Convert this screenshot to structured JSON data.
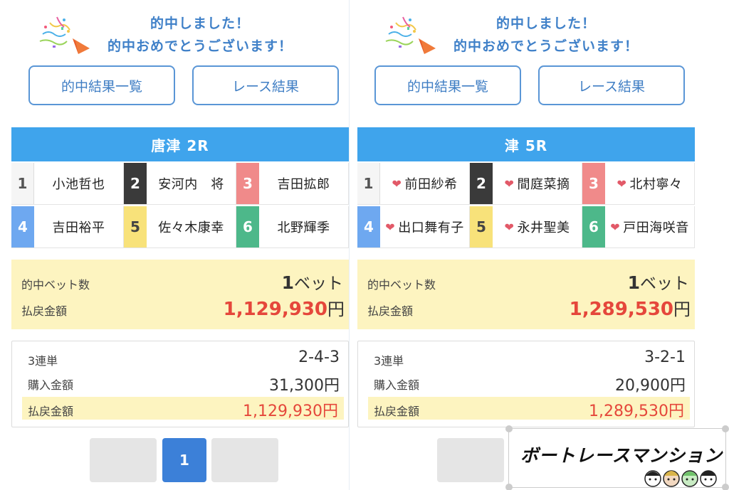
{
  "panels": [
    {
      "congrats_line1": "的中しました！",
      "congrats_line2": "的中おめでとうございます！",
      "btn_results_list": "的中結果一覧",
      "btn_race_results": "レース結果",
      "race_title": "唐津 2R",
      "racers": [
        {
          "boat": "1",
          "name": "小池哲也",
          "heart": false
        },
        {
          "boat": "2",
          "name": "安河内　将",
          "heart": false
        },
        {
          "boat": "3",
          "name": "吉田拡郎",
          "heart": false
        },
        {
          "boat": "4",
          "name": "吉田裕平",
          "heart": false
        },
        {
          "boat": "5",
          "name": "佐々木康幸",
          "heart": false
        },
        {
          "boat": "6",
          "name": "北野輝季",
          "heart": false
        }
      ],
      "hit_bets_label": "的中ベット数",
      "hit_bets_count": "1",
      "hit_bets_unit": "ベット",
      "payout_label": "払戻金額",
      "payout_amount": "1,129,930",
      "yen": "円",
      "bet_type_label": "3連単",
      "bet_combo": "2-4-3",
      "purchase_label": "購入金額",
      "purchase_amount": "31,300円",
      "refund_label": "払戻金額",
      "refund_amount": "1,129,930円",
      "page_current": "1"
    },
    {
      "congrats_line1": "的中しました！",
      "congrats_line2": "的中おめでとうございます！",
      "btn_results_list": "的中結果一覧",
      "btn_race_results": "レース結果",
      "race_title": "津 5R",
      "racers": [
        {
          "boat": "1",
          "name": "前田紗希",
          "heart": true
        },
        {
          "boat": "2",
          "name": "間庭菜摘",
          "heart": true
        },
        {
          "boat": "3",
          "name": "北村寧々",
          "heart": true
        },
        {
          "boat": "4",
          "name": "出口舞有子",
          "heart": true
        },
        {
          "boat": "5",
          "name": "永井聖美",
          "heart": true
        },
        {
          "boat": "6",
          "name": "戸田海咲音",
          "heart": true
        }
      ],
      "hit_bets_label": "的中ベット数",
      "hit_bets_count": "1",
      "hit_bets_unit": "ベット",
      "payout_label": "払戻金額",
      "payout_amount": "1,289,530",
      "yen": "円",
      "bet_type_label": "3連単",
      "bet_combo": "3-2-1",
      "purchase_label": "購入金額",
      "purchase_amount": "20,900円",
      "refund_label": "払戻金額",
      "refund_amount": "1,289,530円"
    }
  ],
  "watermark_text": "ボートレースマンション",
  "icons": {
    "party": "party-popper-icon",
    "heart": "heart-icon"
  },
  "colors": {
    "accent": "#3fa4ec",
    "payout": "#e5473b",
    "highlight": "#fdf4c0"
  }
}
